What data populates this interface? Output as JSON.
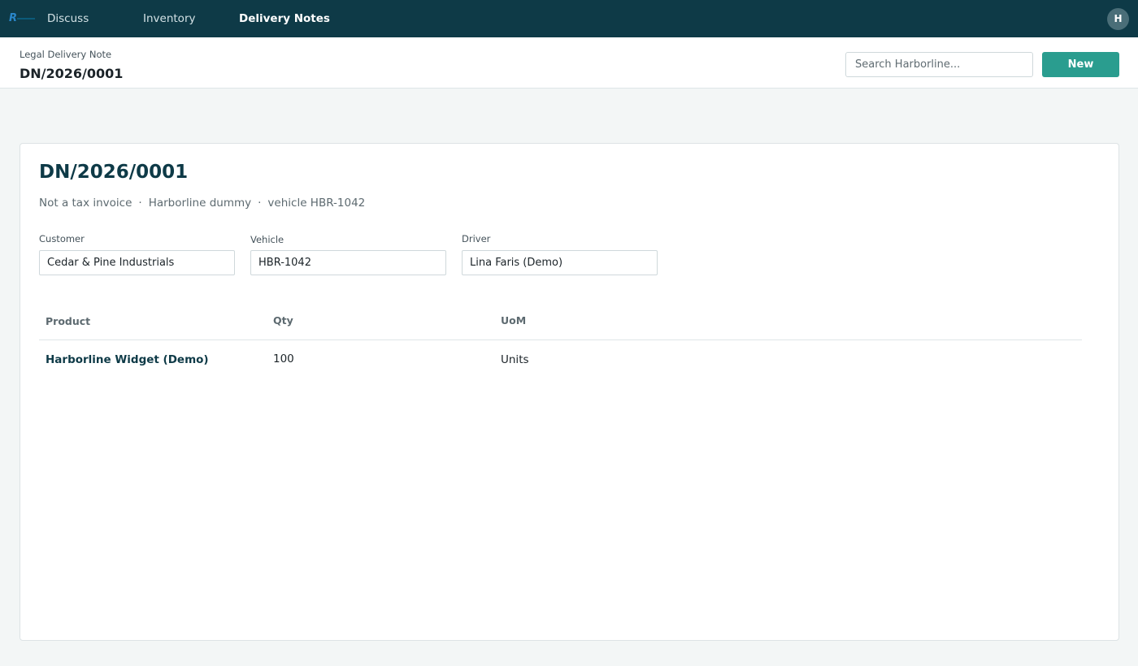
{
  "nav": {
    "items": [
      {
        "label": "Discuss"
      },
      {
        "label": "Inventory"
      },
      {
        "label": "Delivery Notes"
      }
    ],
    "avatar_initial": "H"
  },
  "header": {
    "breadcrumb": "Legal Delivery Note",
    "record_title": "DN/2026/0001",
    "search_placeholder": "Search Harborline...",
    "new_label": "New"
  },
  "document": {
    "title": "DN/2026/0001",
    "meta": [
      "Not a tax invoice",
      "Harborline dummy",
      "vehicle HBR-1042"
    ],
    "meta_separator": "·",
    "fields": {
      "customer": {
        "label": "Customer",
        "value": "Cedar & Pine Industrials"
      },
      "vehicle": {
        "label": "Vehicle",
        "value": "HBR-1042"
      },
      "driver": {
        "label": "Driver",
        "value": "Lina Faris (Demo)"
      }
    },
    "table": {
      "headers": [
        "Product",
        "Qty",
        "UoM"
      ],
      "rows": [
        {
          "product": "Harborline Widget (Demo)",
          "qty": "100",
          "uom": "Units"
        }
      ]
    }
  },
  "colors": {
    "topbar": "#0e3a47",
    "accent": "#2a9d8f",
    "logo_blue": "#1f7fbf"
  },
  "icons": {
    "logo": "harborline-logo-icon"
  }
}
